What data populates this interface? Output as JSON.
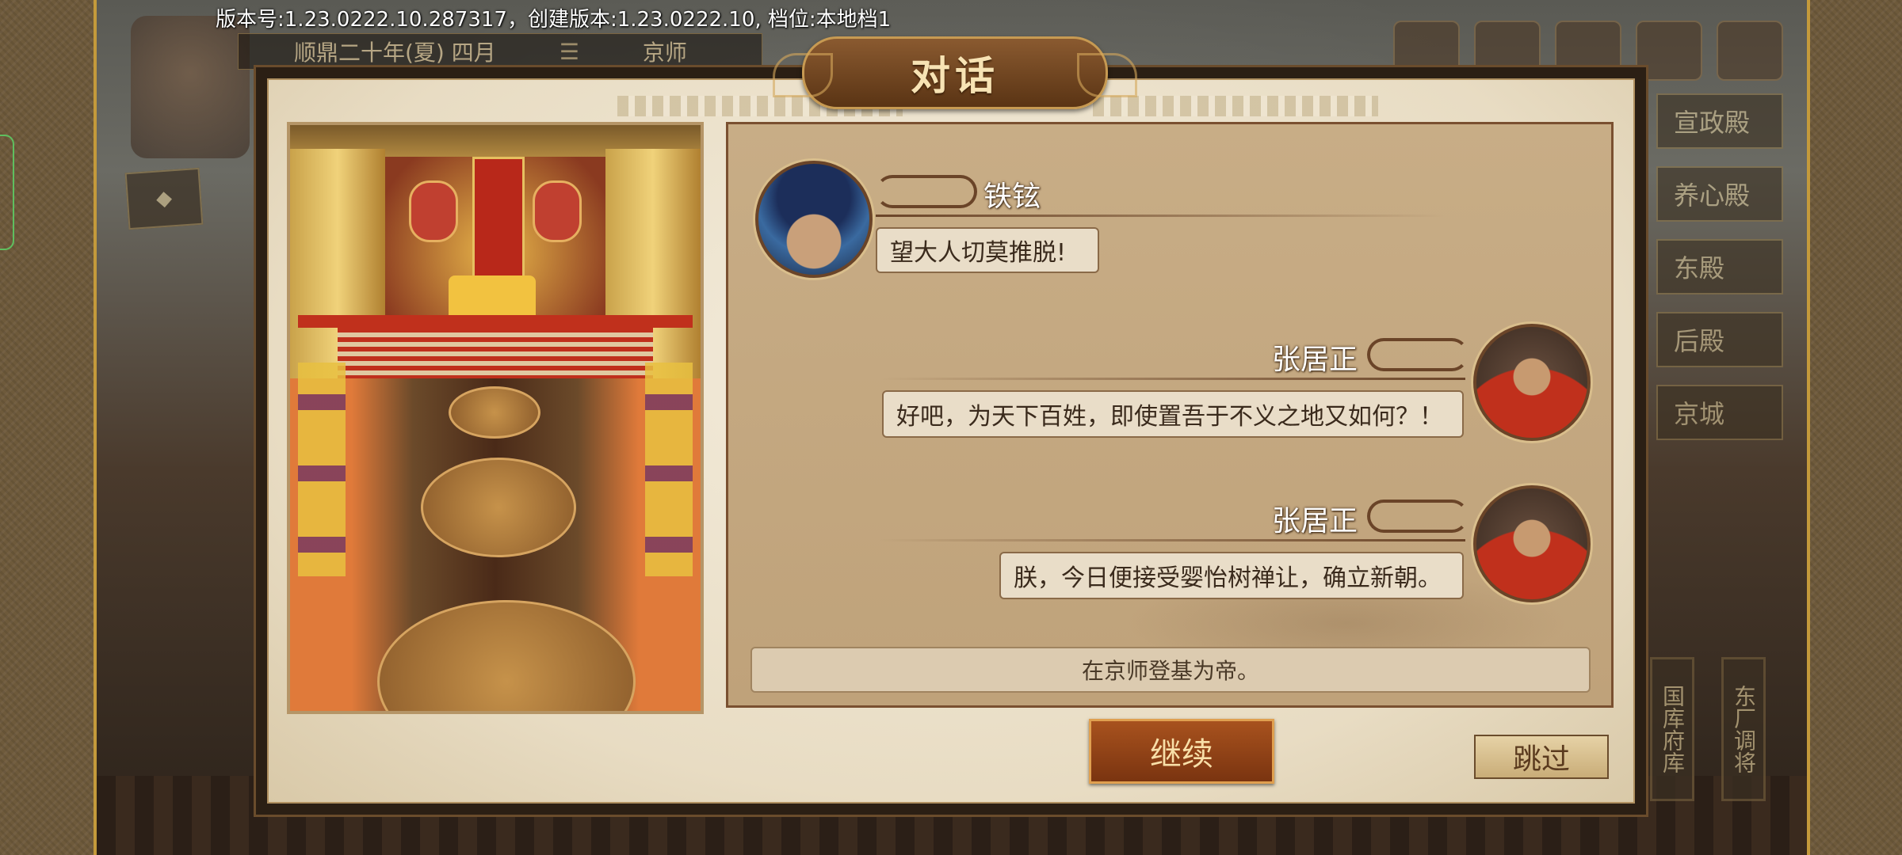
{
  "version_text": "版本号:1.23.0222.10.287317，创建版本:1.23.0222.10, 档位:本地档1",
  "top_bar": {
    "date": "顺鼎二十年(夏) 四月",
    "location": "京师"
  },
  "side_menu": [
    "宣政殿",
    "养心殿",
    "东殿",
    "后殿",
    "京城"
  ],
  "bottom_badges": [
    "国库府库",
    "东厂调将"
  ],
  "dialog": {
    "title": "对话",
    "messages": [
      {
        "speaker": "铁铉",
        "text": "望大人切莫推脱!",
        "side": "left"
      },
      {
        "speaker": "张居正",
        "text": "好吧，为天下百姓，即使置吾于不义之地又如何？！",
        "side": "right"
      },
      {
        "speaker": "张居正",
        "text": "朕，今日便接受婴怡树禅让，确立新朝。",
        "side": "right"
      }
    ],
    "narration": "在京师登基为帝。",
    "continue_label": "继续",
    "skip_label": "跳过"
  },
  "colors": {
    "accent": "#a8521e",
    "panel": "#c8ad86",
    "frame": "#e8dcc3"
  }
}
